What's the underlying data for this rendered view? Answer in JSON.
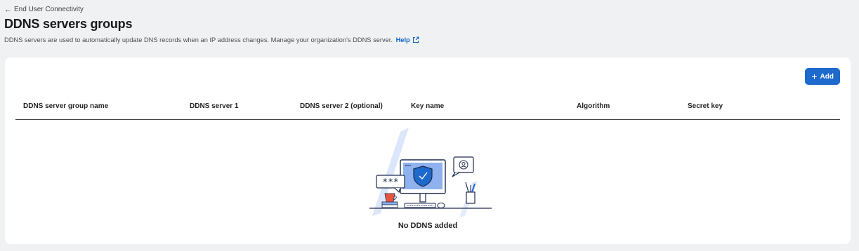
{
  "breadcrumb": {
    "back_label": "End User Connectivity"
  },
  "page": {
    "title": "DDNS servers groups",
    "description": "DDNS servers are used to automatically update DNS records when an IP address changes. Manage your organization's DDNS server.",
    "help_label": "Help"
  },
  "toolbar": {
    "add_label": "Add"
  },
  "table": {
    "columns": [
      "DDNS server group name",
      "DDNS server 1",
      "DDNS server 2 (optional)",
      "Key name",
      "Algorithm",
      "Secret key"
    ],
    "rows": []
  },
  "empty_state": {
    "message": "No DDNS added",
    "illustration": "computer-shield-icon",
    "password_mask": "***"
  },
  "colors": {
    "accent": "#1d69cc",
    "link": "#0b63c9",
    "background": "#f0f1f2",
    "card": "#ffffff"
  }
}
